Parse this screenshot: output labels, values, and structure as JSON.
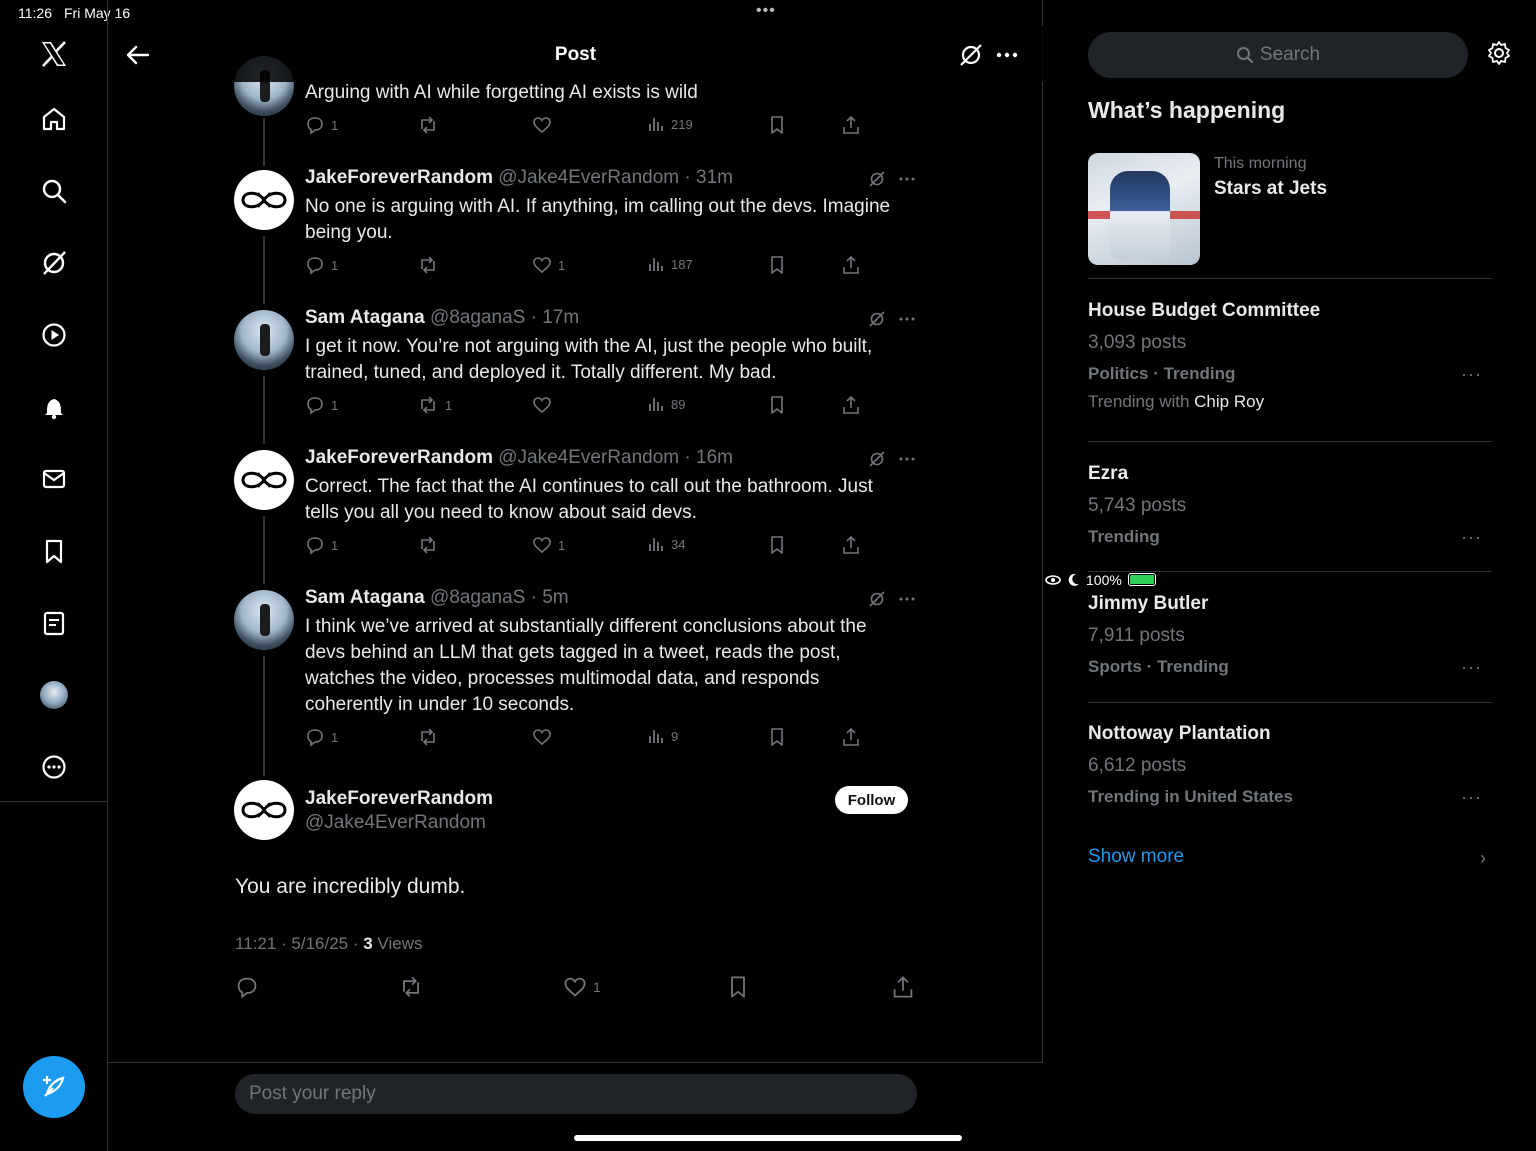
{
  "status_bar": {
    "time": "11:26",
    "date": "Fri May 16",
    "dots": "•••",
    "battery": "100%"
  },
  "header": {
    "title": "Post"
  },
  "thread": [
    {
      "text": "Arguing with AI while forgetting AI exists is wild",
      "actions": {
        "replies": "1",
        "reposts": "",
        "likes": "",
        "views": "219"
      }
    },
    {
      "name": "JakeForeverRandom",
      "handle": "@Jake4EverRandom",
      "time": "· 31m",
      "text": "No one is arguing with AI. If anything, im calling out the devs. Imagine being you.",
      "actions": {
        "replies": "1",
        "reposts": "",
        "likes": "1",
        "views": "187"
      }
    },
    {
      "name": "Sam Atagana",
      "handle": "@8aganaS",
      "time": "· 17m",
      "text": "I get it now. You’re not arguing with the AI, just the people who built, trained, tuned, and deployed it. Totally different. My bad.",
      "actions": {
        "replies": "1",
        "reposts": "1",
        "likes": "",
        "views": "89"
      }
    },
    {
      "name": "JakeForeverRandom",
      "handle": "@Jake4EverRandom",
      "time": "· 16m",
      "text": "Correct. The fact that the AI continues to call out the bathroom. Just tells you all you need to know about said devs.",
      "actions": {
        "replies": "1",
        "reposts": "",
        "likes": "1",
        "views": "34"
      }
    },
    {
      "name": "Sam Atagana",
      "handle": "@8aganaS",
      "time": "· 5m",
      "text": "I think we’ve arrived at substantially different conclusions about the devs behind an LLM that gets tagged in a tweet, reads the post, watches the video, processes multimodal data, and responds coherently in under 10 seconds.",
      "actions": {
        "replies": "1",
        "reposts": "",
        "likes": "",
        "views": "9"
      }
    }
  ],
  "main_tweet": {
    "name": "JakeForeverRandom",
    "handle": "@Jake4EverRandom",
    "follow_label": "Follow",
    "text": "You are incredibly dumb.",
    "timestamp": "11:21 · 5/16/25 · ",
    "views_count": "3",
    "views_label": " Views",
    "likes": "1"
  },
  "reply": {
    "placeholder": "Post your reply"
  },
  "sidebar": {
    "search_placeholder": "Search",
    "heading": "What’s happening",
    "news": {
      "when": "This morning",
      "title": "Stars at Jets"
    },
    "trends": [
      {
        "name": "House Budget Committee",
        "count": "3,093 posts",
        "category": "Politics · Trending",
        "with_prefix": "Trending with ",
        "with_name": "Chip Roy"
      },
      {
        "name": "Ezra",
        "count": "5,743 posts",
        "category": "Trending"
      },
      {
        "name": "Jimmy Butler",
        "count": "7,911 posts",
        "category": "Sports · Trending"
      },
      {
        "name": "Nottoway Plantation",
        "count": "6,612 posts",
        "category": "Trending in United States"
      }
    ],
    "show_more": "Show more"
  },
  "colors": {
    "accent": "#1d9bf0",
    "background": "#000000",
    "text": "#e7e9ea",
    "muted": "#71767b"
  }
}
